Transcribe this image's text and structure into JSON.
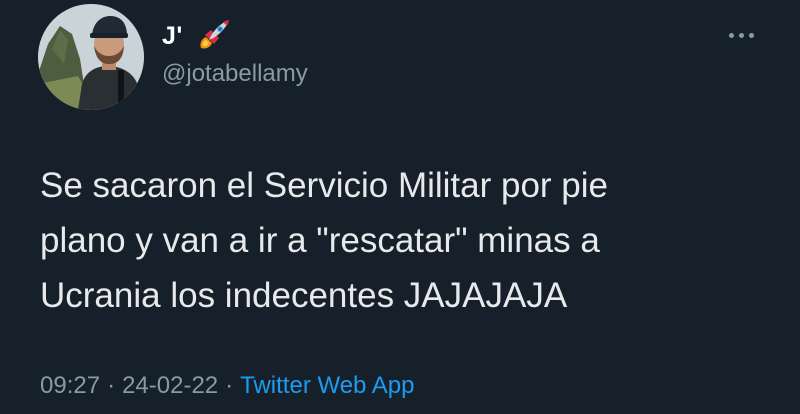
{
  "tweet": {
    "author": {
      "display_name": "J'",
      "name_emoji_icon": "rocket-icon",
      "handle": "@jotabellamy",
      "avatar_icon": "profile-photo"
    },
    "more_options_icon": "more-horizontal-icon",
    "text": "Se sacaron el Servicio Militar por pie\nplano y van a ir a \"rescatar\" minas a\nUcrania los indecentes JAJAJAJA",
    "time": "09:27",
    "date": "24-02-22",
    "separator": "·",
    "source": "Twitter Web App"
  },
  "colors": {
    "background": "#15202b",
    "text": "#e7e9ea",
    "secondary_text": "#8b98a5",
    "link": "#1d9bf0"
  }
}
